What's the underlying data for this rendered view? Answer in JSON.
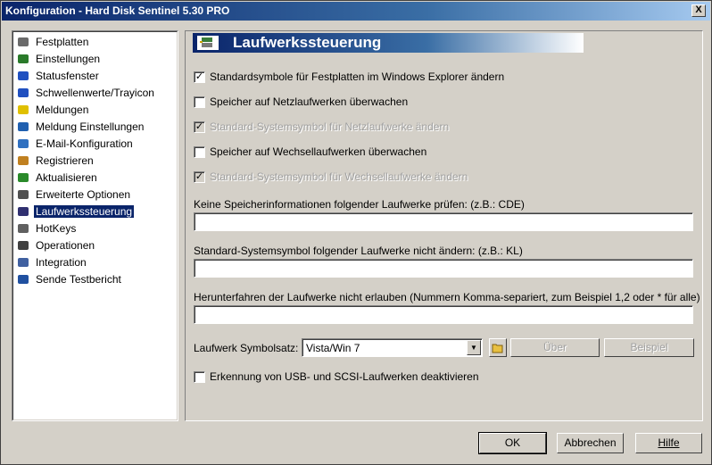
{
  "window": {
    "title": "Konfiguration  -  Hard Disk Sentinel 5.30 PRO",
    "close_label": "X"
  },
  "tree": {
    "items": [
      {
        "label": "Festplatten",
        "icon": "hard-disk-icon"
      },
      {
        "label": "Einstellungen",
        "icon": "settings-globe-icon"
      },
      {
        "label": "Statusfenster",
        "icon": "window-icon"
      },
      {
        "label": "Schwellenwerte/Trayicon",
        "icon": "window-icon"
      },
      {
        "label": "Meldungen",
        "icon": "warning-icon"
      },
      {
        "label": "Meldung Einstellungen",
        "icon": "message-settings-icon"
      },
      {
        "label": "E-Mail-Konfiguration",
        "icon": "email-icon"
      },
      {
        "label": "Registrieren",
        "icon": "register-icon"
      },
      {
        "label": "Aktualisieren",
        "icon": "update-globe-icon"
      },
      {
        "label": "Erweiterte Optionen",
        "icon": "advanced-options-icon"
      },
      {
        "label": "Laufwerkssteuerung",
        "icon": "drive-control-icon"
      },
      {
        "label": "HotKeys",
        "icon": "keyboard-icon"
      },
      {
        "label": "Operationen",
        "icon": "operations-icon"
      },
      {
        "label": "Integration",
        "icon": "integration-icon"
      },
      {
        "label": "Sende Testbericht",
        "icon": "report-icon"
      }
    ],
    "selected_index": 10
  },
  "panel": {
    "title": "Laufwerkssteuerung",
    "checkboxes": [
      {
        "label": "Standardsymbole für Festplatten im Windows Explorer ändern",
        "checked": true,
        "enabled": true
      },
      {
        "label": "Speicher auf Netzlaufwerken überwachen",
        "checked": false,
        "enabled": true
      },
      {
        "label": "Standard-Systemsymbol für Netzlaufwerke ändern",
        "checked": true,
        "enabled": false
      },
      {
        "label": "Speicher auf Wechsellaufwerken überwachen",
        "checked": false,
        "enabled": true
      },
      {
        "label": "Standard-Systemsymbol für Wechsellaufwerke ändern",
        "checked": true,
        "enabled": false
      }
    ],
    "fields": [
      {
        "label": "Keine Speicherinformationen folgender Laufwerke prüfen: (z.B.: CDE)",
        "value": ""
      },
      {
        "label": "Standard-Systemsymbol folgender Laufwerke nicht ändern: (z.B.: KL)",
        "value": ""
      },
      {
        "label": "Herunterfahren der Laufwerke nicht erlauben (Nummern Komma-separiert, zum Beispiel 1,2 oder * für alle)",
        "value": ""
      }
    ],
    "iconset_label": "Laufwerk Symbolsatz:",
    "iconset_value": "Vista/Win 7",
    "about_label": "Über",
    "example_label": "Beispiel",
    "usb_checkbox": {
      "label": "Erkennung von USB- und SCSI-Laufwerken deaktivieren",
      "checked": false
    }
  },
  "footer": {
    "ok_label": "OK",
    "cancel_label": "Abbrechen",
    "help_label": "Hilfe"
  },
  "check_mark": "✓"
}
